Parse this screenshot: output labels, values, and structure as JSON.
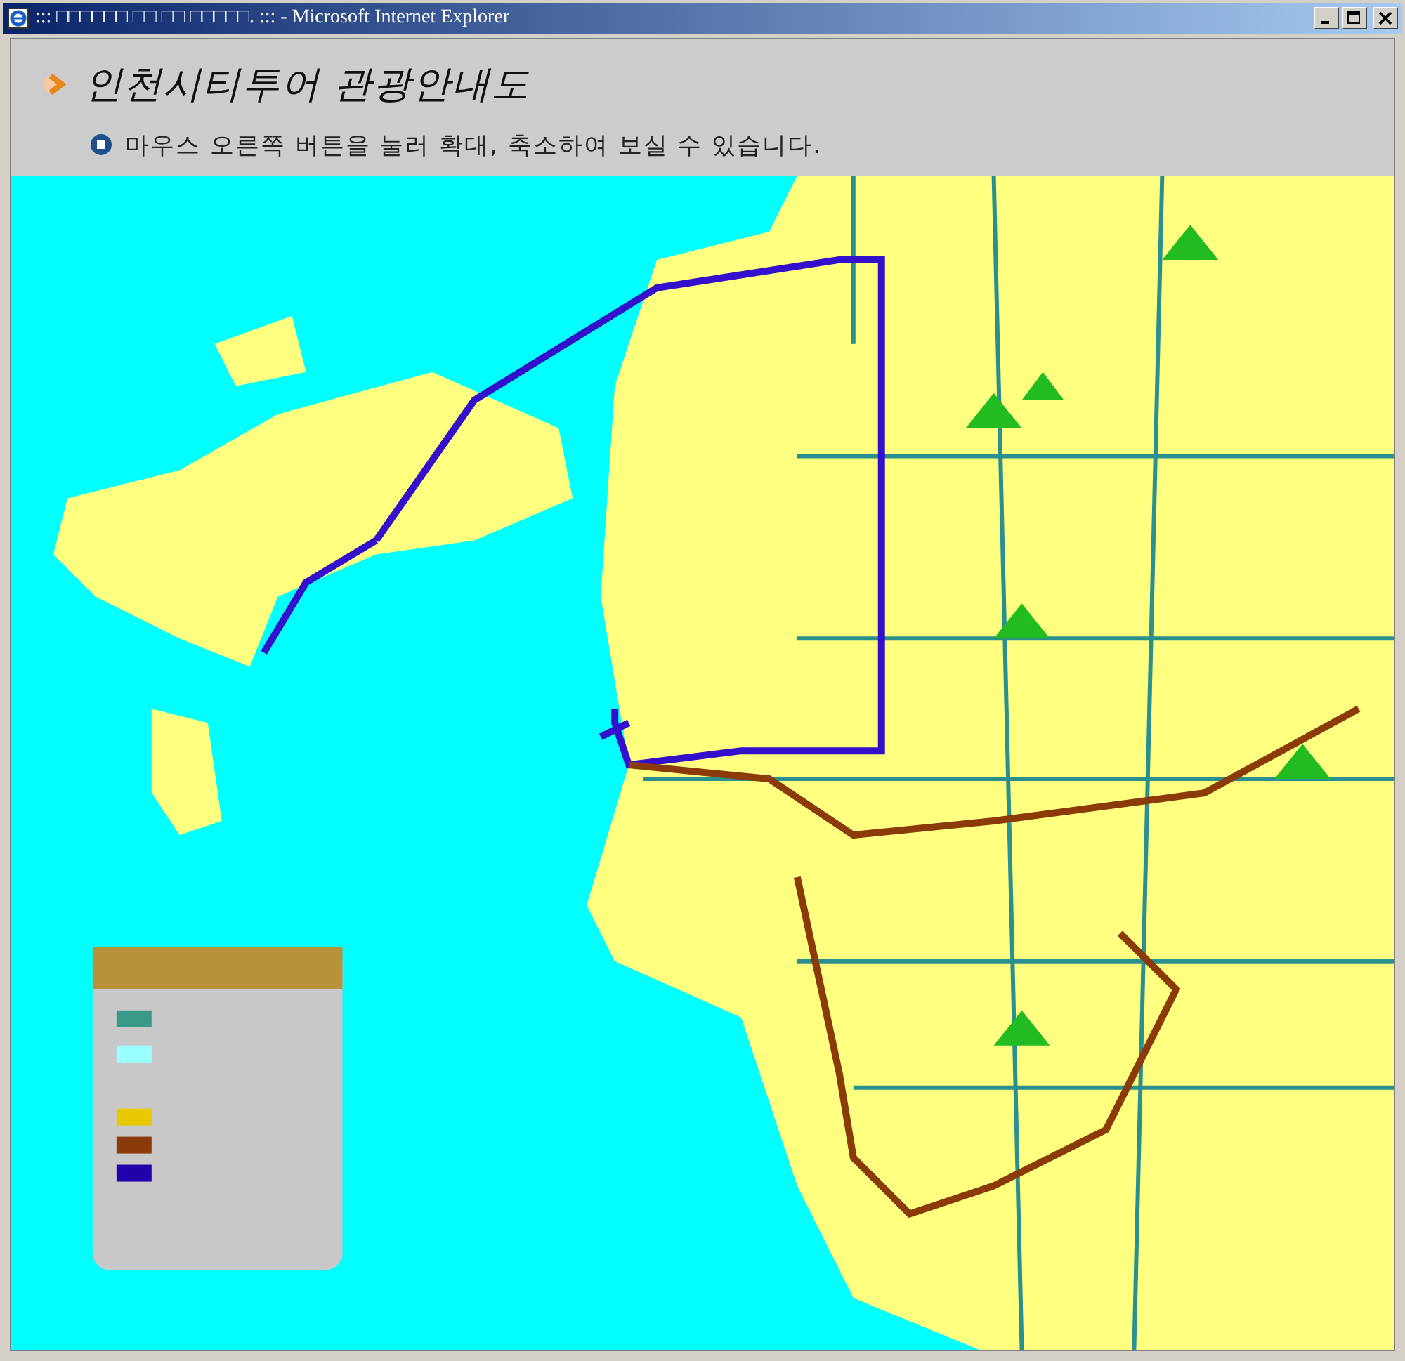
{
  "window": {
    "title": "::: □□□□□□ □□ □□ □□□□□. ::: - Microsoft Internet Explorer"
  },
  "header": {
    "title": "인천시티투어 관광안내도",
    "note": "마우스 오른쪽 버튼을 눌러 확대, 축소하여 보실 수 있습니다."
  }
}
